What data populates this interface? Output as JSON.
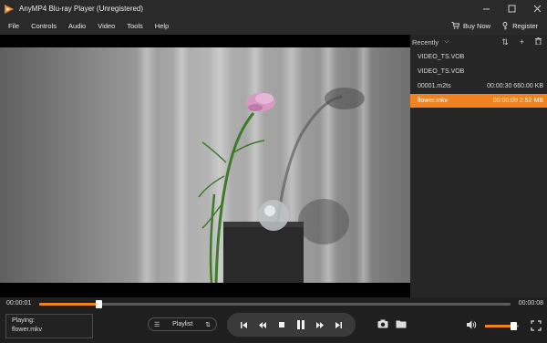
{
  "window": {
    "title": "AnyMP4 Blu-ray Player (Unregistered)",
    "controls": [
      "minimize-icon",
      "maximize-icon",
      "close-icon"
    ]
  },
  "menu": {
    "items": [
      "File",
      "Controls",
      "Audio",
      "Video",
      "Tools",
      "Help"
    ],
    "buy_now": "Buy Now",
    "register": "Register"
  },
  "playlist": {
    "header": "Recently",
    "items": [
      {
        "name": "VIDEO_TS.VOB",
        "duration": "",
        "size": ""
      },
      {
        "name": "VIDEO_TS.VOB",
        "duration": "",
        "size": ""
      },
      {
        "name": "00001.m2ts",
        "duration": "00:00:30",
        "size": "660.00 KB"
      },
      {
        "name": "flower.mkv",
        "duration": "00:00:09",
        "size": "2.52 MB",
        "active": true
      }
    ]
  },
  "progress": {
    "current": "00:00:01",
    "total": "00:00:08",
    "fraction": 0.125
  },
  "status": {
    "playing_label": "Playing:",
    "file": "flower.mkv"
  },
  "controls": {
    "playlist_label": "Playlist",
    "volume_fraction": 0.85
  },
  "colors": {
    "accent": "#f08220",
    "background": "#232323"
  }
}
